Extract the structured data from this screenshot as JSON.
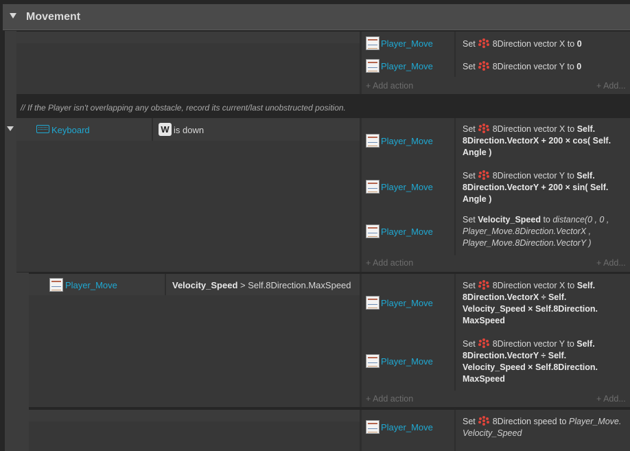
{
  "group": {
    "title": "Movement"
  },
  "labels": {
    "add_action": "Add action",
    "add_short": "Add..."
  },
  "comment": "//  If the Player isn't overlapping any obstacle, record its current/last unobstructed position.",
  "events": [
    {
      "actions": [
        {
          "object": "Player_Move",
          "pre": "Set ",
          "post": "8Direction vector X to ",
          "value": "0"
        },
        {
          "object": "Player_Move",
          "pre": "Set ",
          "post": "8Direction vector Y to ",
          "value": "0"
        }
      ]
    },
    {
      "condition": {
        "object": "Keyboard",
        "key": "W",
        "text": "is down"
      },
      "actions": [
        {
          "object": "Player_Move",
          "pre": "Set ",
          "post": "8Direction vector X to ",
          "b1": "Self. 8Direction.VectorX + 200 × cos( Self. Angle )"
        },
        {
          "object": "Player_Move",
          "pre": "Set ",
          "post": "8Direction vector Y to ",
          "b1": "Self. 8Direction.VectorY + 200 × sin( Self. Angle )"
        },
        {
          "object": "Player_Move",
          "pre": "Set ",
          "b1": "Velocity_Speed",
          "mid": " to ",
          "i1": "distance(0 , 0 , Player_Move.8Direction.VectorX , Player_Move.8Direction.VectorY )"
        }
      ]
    },
    {
      "condition": {
        "object": "Player_Move",
        "b1": "Velocity_Speed",
        "text": " > Self.8Direction.MaxSpeed"
      },
      "actions": [
        {
          "object": "Player_Move",
          "pre": "Set ",
          "post": "8Direction vector X to ",
          "b1": "Self. 8Direction.VectorX ÷ Self. Velocity_Speed × Self.8Direction. MaxSpeed"
        },
        {
          "object": "Player_Move",
          "pre": "Set ",
          "post": "8Direction vector Y to ",
          "b1": "Self. 8Direction.VectorY ÷ Self. Velocity_Speed × Self.8Direction. MaxSpeed"
        }
      ]
    },
    {
      "actions": [
        {
          "object": "Player_Move",
          "pre": "Set ",
          "post": "8Direction speed to ",
          "i1": "Player_Move. Velocity_Speed"
        }
      ]
    }
  ]
}
